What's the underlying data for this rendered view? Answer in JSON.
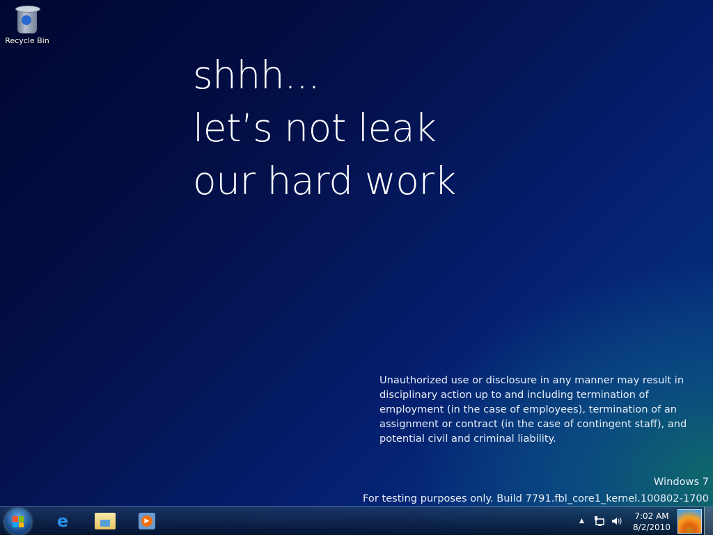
{
  "desktop": {
    "icons": [
      {
        "label": "Recycle Bin",
        "icon": "recycle-bin-icon"
      }
    ]
  },
  "headline": [
    "shhh...",
    "let’s not leak",
    "our hard work"
  ],
  "legal_text": "Unauthorized use or disclosure in any manner may result in disciplinary action up to and including termination of employment (in the case of employees), termination of an assignment or contract (in the case of contingent staff), and potential civil and criminal liability.",
  "watermark": {
    "product": "Windows 7",
    "build": "For testing purposes only. Build 7791.fbl_core1_kernel.100802-1700"
  },
  "taskbar": {
    "pinned": [
      {
        "name": "internet-explorer",
        "icon": "ie-icon"
      },
      {
        "name": "windows-explorer",
        "icon": "folder-icon"
      },
      {
        "name": "windows-media-player",
        "icon": "media-player-icon"
      }
    ],
    "tray": {
      "overflow": "▲",
      "network": "network-icon",
      "volume": "volume-icon"
    },
    "clock": {
      "time": "7:02 AM",
      "date": "8/2/2010"
    }
  }
}
